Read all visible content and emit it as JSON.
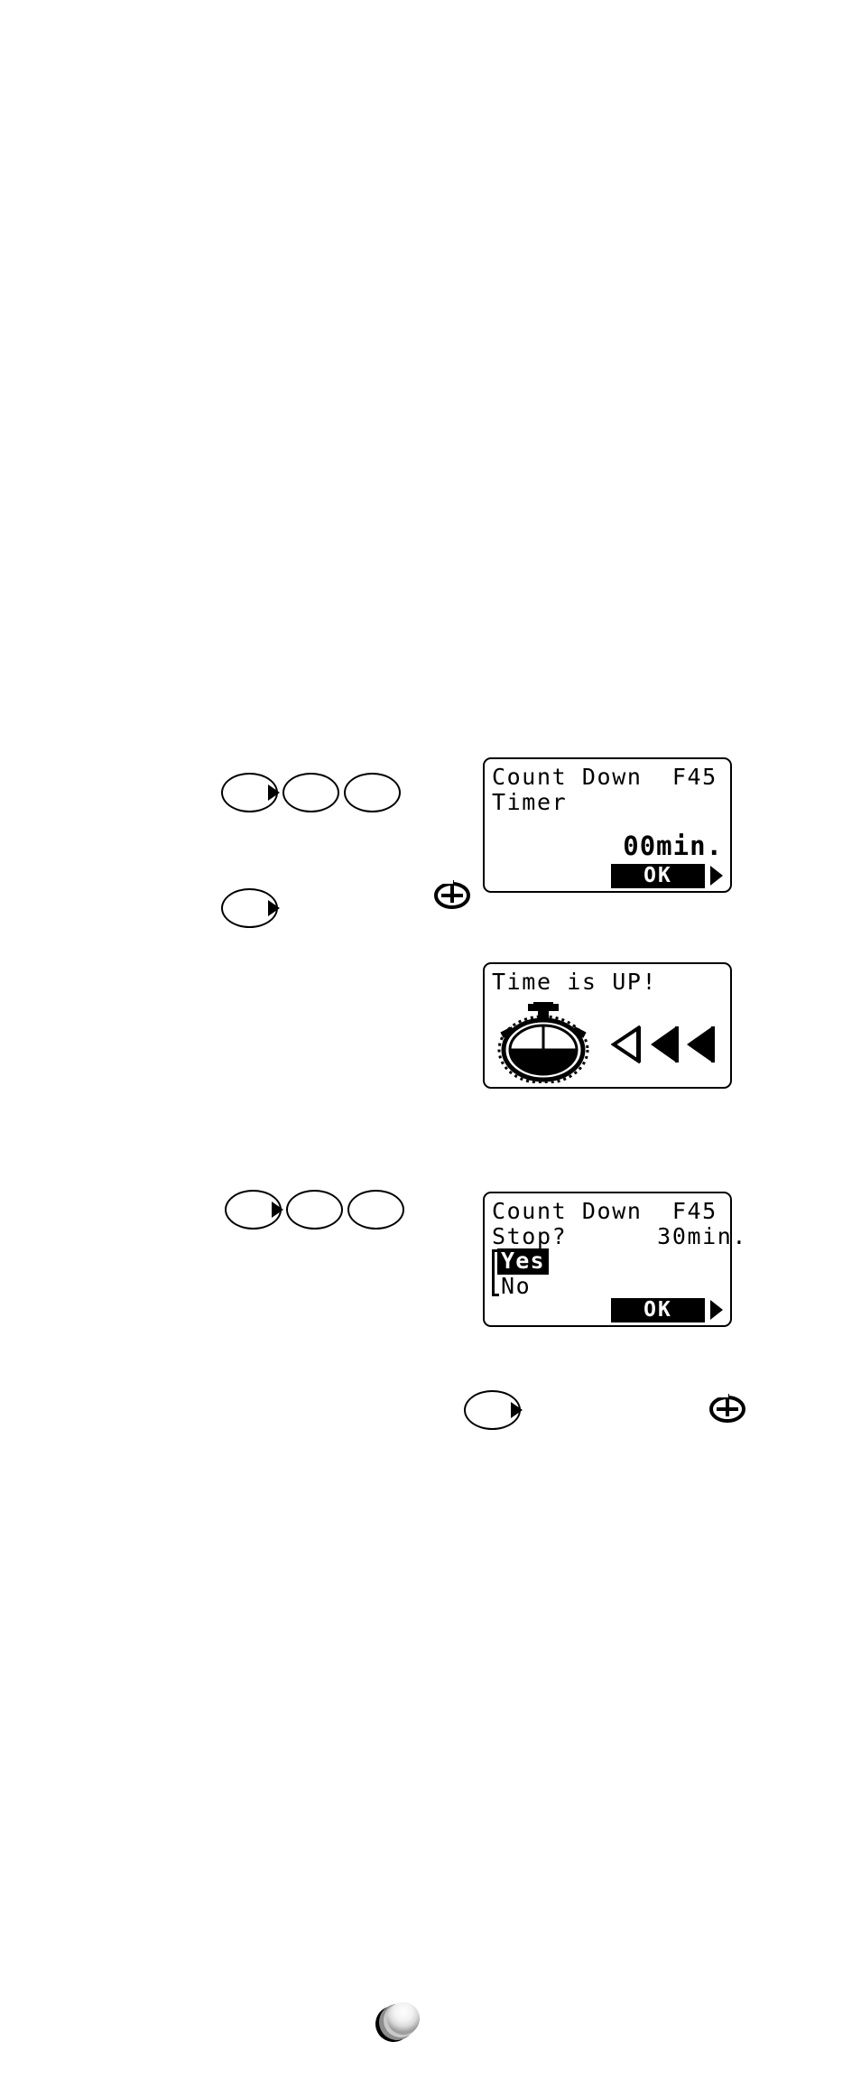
{
  "screens": [
    {
      "id": "countdown-timer-setup",
      "lines": [
        {
          "text": "Count Down  F45"
        },
        {
          "text": "Timer"
        }
      ],
      "value": "00min.",
      "softkey": "OK"
    },
    {
      "id": "time-is-up",
      "lines": [
        {
          "text": "Time is UP!"
        }
      ],
      "icons": [
        "stopwatch-icon",
        "play-marker-outline-icon",
        "rewind-marker-icon",
        "rewind-marker-icon"
      ]
    },
    {
      "id": "countdown-stop-confirm",
      "lines": [
        {
          "text": "Count Down  F45"
        },
        {
          "text": "Stop?      30min."
        }
      ],
      "options": [
        {
          "label": "Yes",
          "selected": true
        },
        {
          "label": "No",
          "selected": false
        }
      ],
      "softkey": "OK"
    }
  ],
  "controls": {
    "row1": [
      {
        "name": "softkey-button-1",
        "arrow": true
      },
      {
        "name": "softkey-button-2",
        "arrow": false
      },
      {
        "name": "softkey-button-3",
        "arrow": false
      }
    ],
    "row2": [
      {
        "name": "softkey-button-1",
        "arrow": true
      }
    ],
    "row3": [
      {
        "name": "softkey-button-1",
        "arrow": true
      },
      {
        "name": "softkey-button-2",
        "arrow": false
      },
      {
        "name": "softkey-button-3",
        "arrow": false
      }
    ],
    "row4": [
      {
        "name": "softkey-button-1",
        "arrow": true
      }
    ],
    "power_icons": [
      "power-icon",
      "power-icon"
    ]
  },
  "colors": {
    "ink": "#000000",
    "paper": "#ffffff",
    "inverted_text": "#ffffff"
  }
}
